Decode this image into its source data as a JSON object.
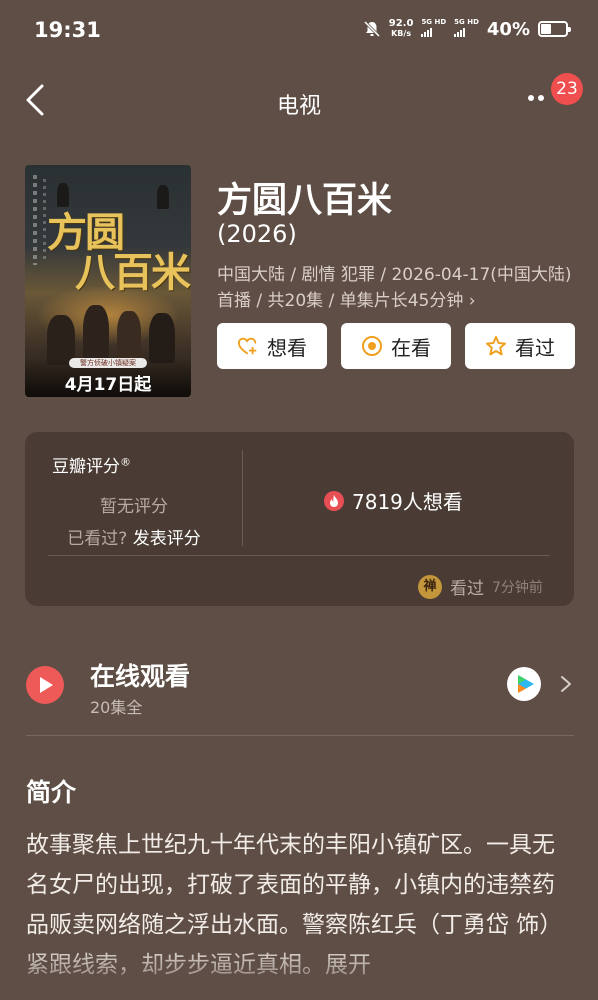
{
  "status_bar": {
    "time": "19:31",
    "net_speed_value": "92.0",
    "net_speed_unit": "KB/s",
    "sim1": "5G HD",
    "sim2": "5G HD",
    "battery": "40%"
  },
  "nav": {
    "title": "电视",
    "badge_count": "23"
  },
  "poster": {
    "title_line1": "方圆",
    "title_line2": "八百米",
    "tagline": "警方侦破小镇疑案",
    "date": "4月17日起"
  },
  "show": {
    "title": "方圆八百米",
    "year": "(2026)",
    "meta": "中国大陆 / 剧情 犯罪 / 2026-04-17(中国大陆)首播 / 共20集 / 单集片长45分钟 ›"
  },
  "actions": {
    "want": "想看",
    "watching": "在看",
    "watched": "看过"
  },
  "rating": {
    "label": "豆瓣评分",
    "registered": "®",
    "no_rating": "暂无评分",
    "seen_prompt": "已看过?",
    "post_rating": "发表评分",
    "want_count": "7819人想看",
    "activity_avatar": "禅",
    "activity_label": "看过",
    "activity_time": "7分钟前"
  },
  "online": {
    "title": "在线观看",
    "episodes": "20集全"
  },
  "synopsis": {
    "title": "简介",
    "text": "故事聚焦上世纪九十年代末的丰阳小镇矿区。一具无名女尸的出现，打破了表面的平静，小镇内的违禁药品贩卖网络随之浮出水面。警察陈红兵（丁勇岱 饰）紧跟线索，却步步逼近真相。展开"
  },
  "colors": {
    "background": "#5e4e45",
    "card": "#4a3c34",
    "badge": "#ef4f4f",
    "play": "#ee5a58",
    "accent_orange": "#f0a020"
  }
}
